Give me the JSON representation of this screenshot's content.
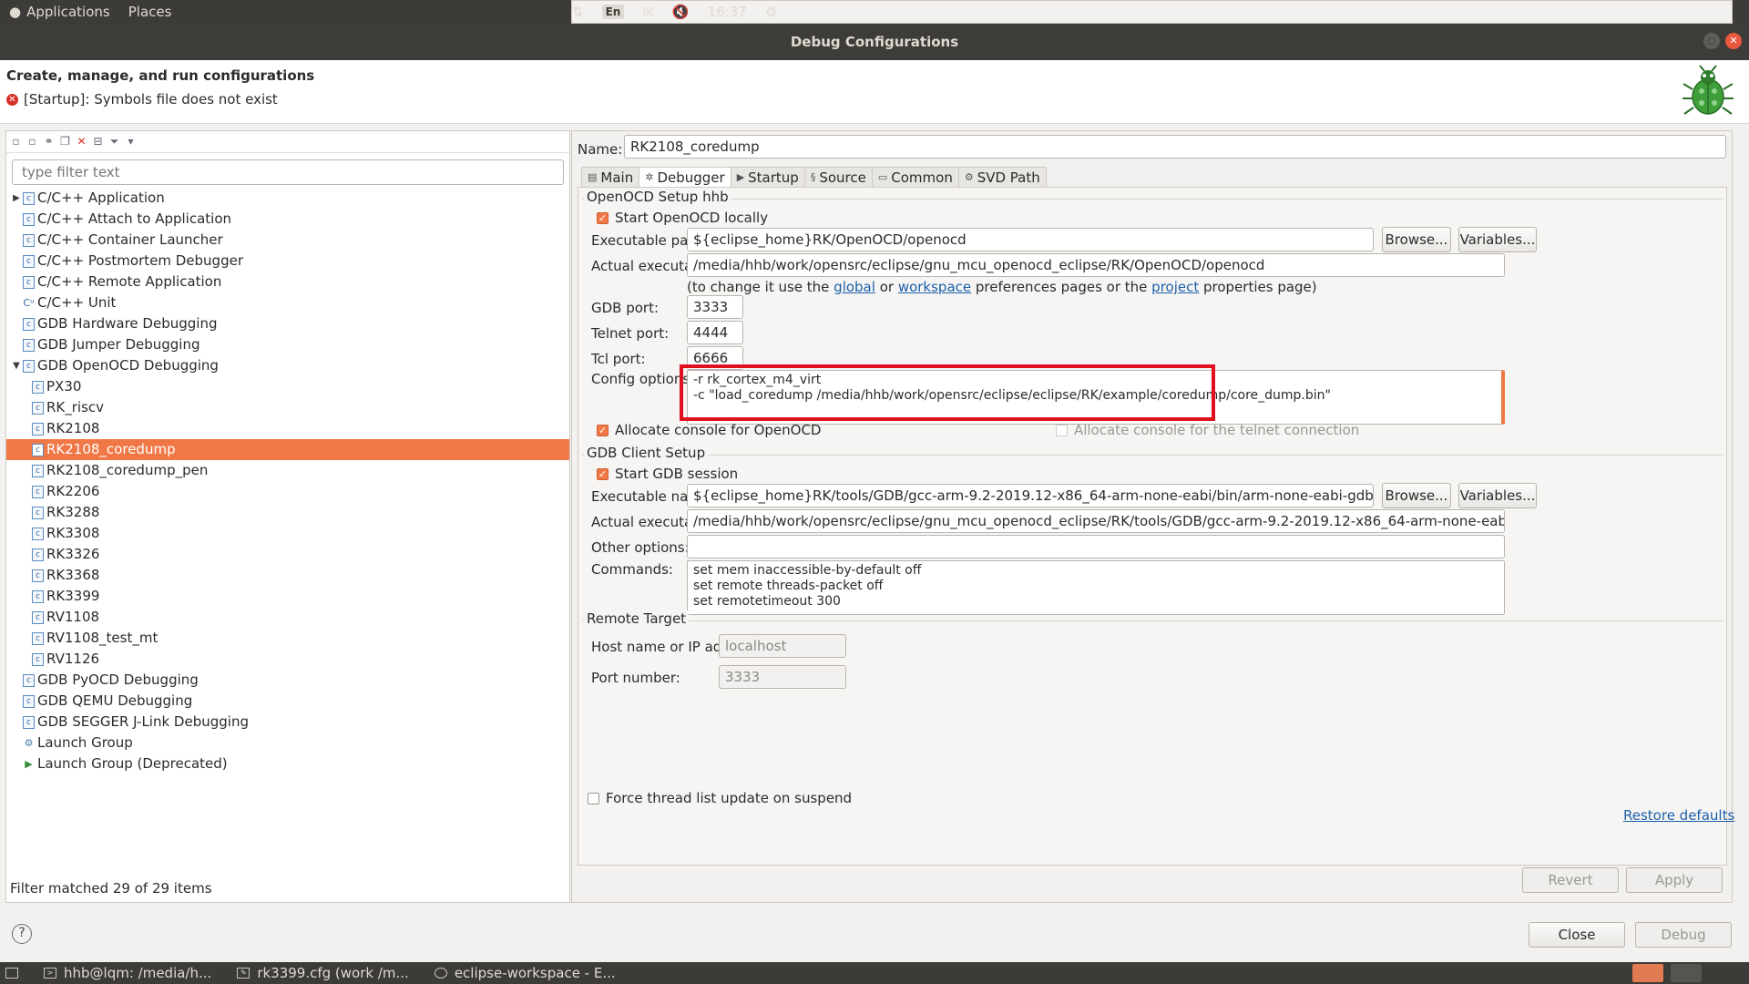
{
  "topbar": {
    "applications": "Applications",
    "places": "Places",
    "lang": "En",
    "clock": "16:37"
  },
  "window": {
    "title": "Debug Configurations"
  },
  "header": {
    "title": "Create, manage, and run configurations",
    "error": "[Startup]: Symbols file does not exist"
  },
  "left": {
    "filter_placeholder": "type filter text",
    "tree": [
      {
        "label": "C/C++ Application",
        "level": 0,
        "twisty": "closed",
        "icon": "c"
      },
      {
        "label": "C/C++ Attach to Application",
        "level": 0,
        "icon": "c"
      },
      {
        "label": "C/C++ Container Launcher",
        "level": 0,
        "icon": "c"
      },
      {
        "label": "C/C++ Postmortem Debugger",
        "level": 0,
        "icon": "c"
      },
      {
        "label": "C/C++ Remote Application",
        "level": 0,
        "icon": "c"
      },
      {
        "label": "C/C++ Unit",
        "level": 0,
        "icon": "cu"
      },
      {
        "label": "GDB Hardware Debugging",
        "level": 0,
        "icon": "c"
      },
      {
        "label": "GDB Jumper Debugging",
        "level": 0,
        "icon": "c"
      },
      {
        "label": "GDB OpenOCD Debugging",
        "level": 0,
        "twisty": "open",
        "icon": "c"
      },
      {
        "label": "PX30",
        "level": 1,
        "icon": "c"
      },
      {
        "label": "RK_riscv",
        "level": 1,
        "icon": "c"
      },
      {
        "label": "RK2108",
        "level": 1,
        "icon": "c"
      },
      {
        "label": "RK2108_coredump",
        "level": 1,
        "icon": "c",
        "selected": true
      },
      {
        "label": "RK2108_coredump_pen",
        "level": 1,
        "icon": "c"
      },
      {
        "label": "RK2206",
        "level": 1,
        "icon": "c"
      },
      {
        "label": "RK3288",
        "level": 1,
        "icon": "c"
      },
      {
        "label": "RK3308",
        "level": 1,
        "icon": "c"
      },
      {
        "label": "RK3326",
        "level": 1,
        "icon": "c"
      },
      {
        "label": "RK3368",
        "level": 1,
        "icon": "c"
      },
      {
        "label": "RK3399",
        "level": 1,
        "icon": "c"
      },
      {
        "label": "RV1108",
        "level": 1,
        "icon": "c"
      },
      {
        "label": "RV1108_test_mt",
        "level": 1,
        "icon": "c"
      },
      {
        "label": "RV1126",
        "level": 1,
        "icon": "c"
      },
      {
        "label": "GDB PyOCD Debugging",
        "level": 0,
        "icon": "c"
      },
      {
        "label": "GDB QEMU Debugging",
        "level": 0,
        "icon": "c"
      },
      {
        "label": "GDB SEGGER J-Link Debugging",
        "level": 0,
        "icon": "c"
      },
      {
        "label": "Launch Group",
        "level": 0,
        "icon": "group"
      },
      {
        "label": "Launch Group (Deprecated)",
        "level": 0,
        "icon": "play"
      }
    ],
    "status": "Filter matched 29 of 29 items"
  },
  "right": {
    "name_label": "Name:",
    "name_value": "RK2108_coredump",
    "tabs": [
      "Main",
      "Debugger",
      "Startup",
      "Source",
      "Common",
      "SVD Path"
    ],
    "openocd": {
      "group_title": "OpenOCD Setup hhb",
      "start_locally": "Start OpenOCD locally",
      "exec_path_label": "Executable path:",
      "exec_path_value": "${eclipse_home}RK/OpenOCD/openocd",
      "browse": "Browse...",
      "variables": "Variables...",
      "actual_label": "Actual executable:",
      "actual_value": "/media/hhb/work/opensrc/eclipse/gnu_mcu_openocd_eclipse/RK/OpenOCD/openocd",
      "hint_1": "(to change it use the ",
      "hint_global": "global",
      "hint_2": " or ",
      "hint_workspace": "workspace",
      "hint_3": " preferences pages or the ",
      "hint_project": "project",
      "hint_4": " properties page)",
      "gdb_port_label": "GDB port:",
      "gdb_port": "3333",
      "telnet_port_label": "Telnet port:",
      "telnet_port": "4444",
      "tcl_port_label": "Tcl port:",
      "tcl_port": "6666",
      "config_label": "Config options:",
      "config_value": "-r rk_cortex_m4_virt\n-c \"load_coredump /media/hhb/work/opensrc/eclipse/eclipse/RK/example/coredump/core_dump.bin\"",
      "alloc_console": "Allocate console for OpenOCD",
      "alloc_telnet": "Allocate console for the telnet connection"
    },
    "gdb": {
      "group_title": "GDB Client Setup",
      "start_session": "Start GDB session",
      "exec_name_label": "Executable name:",
      "exec_name_value": "${eclipse_home}RK/tools/GDB/gcc-arm-9.2-2019.12-x86_64-arm-none-eabi/bin/arm-none-eabi-gdb",
      "browse": "Browse...",
      "variables": "Variables...",
      "actual_label": "Actual executable:",
      "actual_value": "/media/hhb/work/opensrc/eclipse/gnu_mcu_openocd_eclipse/RK/tools/GDB/gcc-arm-9.2-2019.12-x86_64-arm-none-eabi/bin/arm-none-eabi-gdb",
      "other_label": "Other options:",
      "other_value": "",
      "commands_label": "Commands:",
      "commands_value": "set mem inaccessible-by-default off\nset remote threads-packet off\nset remotetimeout 300"
    },
    "remote": {
      "group_title": "Remote Target",
      "host_label": "Host name or IP address:",
      "host_value": "localhost",
      "port_label": "Port number:",
      "port_value": "3333"
    },
    "force_thread": "Force thread list update on suspend",
    "restore_defaults": "Restore defaults",
    "revert": "Revert",
    "apply": "Apply"
  },
  "footer": {
    "close": "Close",
    "debug": "Debug",
    "help": "?"
  },
  "taskbar": {
    "items": [
      "hhb@lqm: /media/h...",
      "rk3399.cfg (work /m...",
      "eclipse-workspace - E..."
    ]
  },
  "colors": {
    "selection": "#f07746",
    "highlight_box": "#e0101e",
    "panel_dark": "#3c3b37"
  }
}
